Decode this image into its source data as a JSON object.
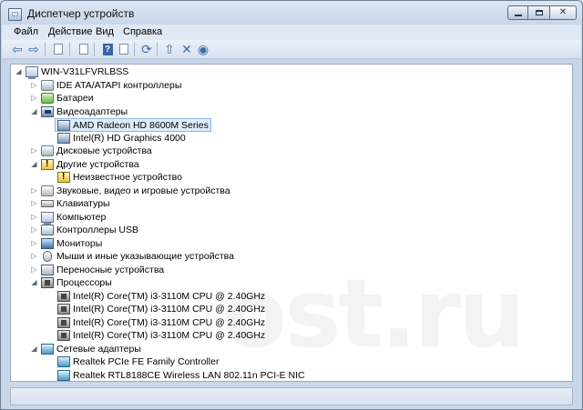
{
  "window": {
    "title": "Диспетчер устройств",
    "controls": {
      "minimize": "",
      "maximize": "",
      "close": "✕"
    }
  },
  "menu": {
    "items": [
      "Файл",
      "Действие",
      "Вид",
      "Справка"
    ]
  },
  "toolbar": {
    "icons": [
      "back-arrow-icon",
      "forward-arrow-icon",
      "properties-icon",
      "document-icon",
      "help-icon",
      "refresh-icon",
      "update-driver-icon",
      "disable-device-icon",
      "uninstall-device-icon"
    ]
  },
  "tree": {
    "root": "WIN-V31LFVRLBSS",
    "categories": [
      {
        "label": "IDE ATA/ATAPI контроллеры",
        "icon": "disk-icon"
      },
      {
        "label": "Батареи",
        "icon": "battery-icon"
      },
      {
        "label": "Видеоадаптеры",
        "icon": "display-adapter-icon",
        "children": [
          "AMD Radeon HD 8600M Series",
          "Intel(R) HD Graphics 4000"
        ]
      },
      {
        "label": "Дисковые устройства",
        "icon": "disk-drive-icon"
      },
      {
        "label": "Другие устройства",
        "icon": "warning-device-icon",
        "children": [
          "Неизвестное устройство"
        ]
      },
      {
        "label": "Звуковые, видео и игровые устройства",
        "icon": "sound-icon"
      },
      {
        "label": "Клавиатуры",
        "icon": "keyboard-icon"
      },
      {
        "label": "Компьютер",
        "icon": "computer-icon"
      },
      {
        "label": "Контроллеры USB",
        "icon": "usb-icon"
      },
      {
        "label": "Мониторы",
        "icon": "monitor-icon"
      },
      {
        "label": "Мыши и иные указывающие устройства",
        "icon": "mouse-icon"
      },
      {
        "label": "Переносные устройства",
        "icon": "portable-device-icon"
      },
      {
        "label": "Процессоры",
        "icon": "processor-icon",
        "children": [
          "Intel(R) Core(TM) i3-3110M CPU @ 2.40GHz",
          "Intel(R) Core(TM) i3-3110M CPU @ 2.40GHz",
          "Intel(R) Core(TM) i3-3110M CPU @ 2.40GHz",
          "Intel(R) Core(TM) i3-3110M CPU @ 2.40GHz"
        ]
      },
      {
        "label": "Сетевые адаптеры",
        "icon": "network-adapter-icon",
        "children": [
          "Realtek PCIe FE Family Controller",
          "Realtek RTL8188CE Wireless LAN 802.11n PCI-E NIC"
        ]
      }
    ],
    "selected": "AMD Radeon HD 8600M Series"
  },
  "watermark": "ost.ru"
}
